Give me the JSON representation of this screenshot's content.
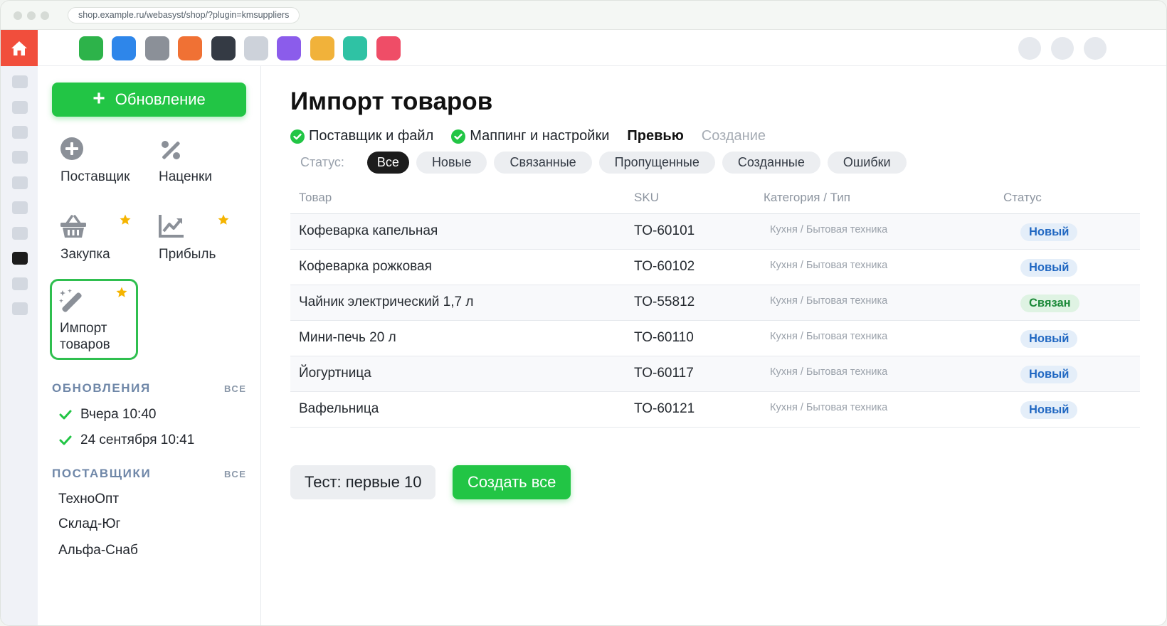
{
  "browser": {
    "url": "shop.example.ru/webasyst/shop/?plugin=kmsuppliers"
  },
  "colors": {
    "accent_green": "#22c545",
    "home_red": "#f14e3c",
    "badge_new_text": "#2168c2",
    "badge_linked_text": "#1d8a3a",
    "star": "#f5b400"
  },
  "appbar": {
    "home_icon": "home-icon",
    "app_tiles": [
      "#2db34a",
      "#2e86ea",
      "#8b9098",
      "#f07134",
      "#343a44",
      "#cdd2da",
      "#8b5ceb",
      "#f1b23a",
      "#2fc2a4",
      "#ef4d67"
    ]
  },
  "sidebar": {
    "update_button": "Обновление",
    "tools": [
      {
        "label": "Поставщик",
        "icon": "plus-circle-icon",
        "starred": false
      },
      {
        "label": "Наценки",
        "icon": "percent-icon",
        "starred": false
      },
      {
        "label": "Закупка",
        "icon": "basket-icon",
        "starred": true
      },
      {
        "label": "Прибыль",
        "icon": "chart-line-icon",
        "starred": true
      },
      {
        "label": "Импорт\nтоваров",
        "icon": "magic-wand-icon",
        "starred": true,
        "selected": true
      }
    ],
    "updates": {
      "title": "ОБНОВЛЕНИЯ",
      "all": "ВСЕ",
      "items": [
        "Вчера 10:40",
        "24 сентября 10:41"
      ]
    },
    "suppliers": {
      "title": "ПОСТАВЩИКИ",
      "all": "ВСЕ",
      "items": [
        "ТехноОпт",
        "Склад-Юг",
        "Альфа-Снаб"
      ]
    }
  },
  "main": {
    "title": "Импорт товаров",
    "steps": [
      {
        "label": "Поставщик и файл",
        "state": "done"
      },
      {
        "label": "Маппинг и настройки",
        "state": "done"
      },
      {
        "label": "Превью",
        "state": "current"
      },
      {
        "label": "Создание",
        "state": "pending"
      }
    ],
    "filters": {
      "label": "Статус:",
      "options": [
        "Все",
        "Новые",
        "Связанные",
        "Пропущенные",
        "Созданные",
        "Ошибки"
      ],
      "selected": "Все"
    },
    "table": {
      "headers": [
        "Товар",
        "SKU",
        "Категория / Тип",
        "Статус"
      ],
      "rows": [
        {
          "name": "Кофеварка капельная",
          "sku": "TO-60101",
          "category": "Кухня / Бытовая техника",
          "status": "Новый"
        },
        {
          "name": "Кофеварка рожковая",
          "sku": "TO-60102",
          "category": "Кухня / Бытовая техника",
          "status": "Новый"
        },
        {
          "name": "Чайник электрический 1,7 л",
          "sku": "TO-55812",
          "category": "Кухня / Бытовая техника",
          "status": "Связан"
        },
        {
          "name": "Мини-печь 20 л",
          "sku": "TO-60110",
          "category": "Кухня / Бытовая техника",
          "status": "Новый"
        },
        {
          "name": "Йогуртница",
          "sku": "TO-60117",
          "category": "Кухня / Бытовая техника",
          "status": "Новый"
        },
        {
          "name": "Вафельница",
          "sku": "TO-60121",
          "category": "Кухня / Бытовая техника",
          "status": "Новый"
        }
      ]
    },
    "actions": {
      "test": "Тест: первые 10",
      "create": "Создать все"
    }
  }
}
